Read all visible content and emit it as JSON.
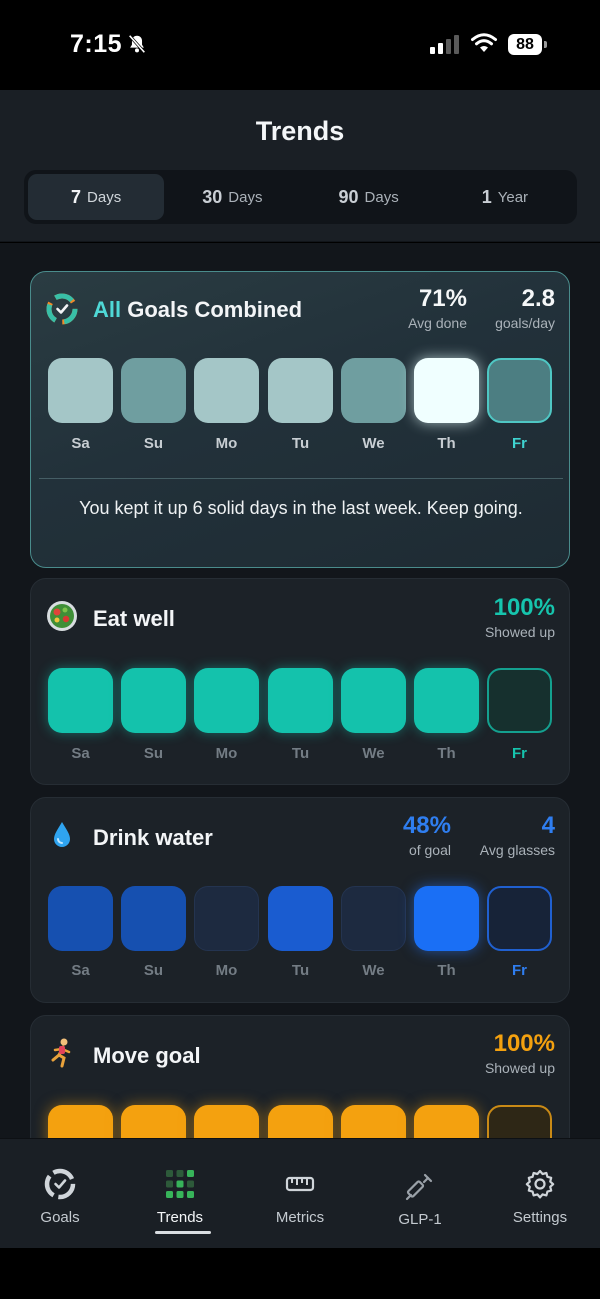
{
  "status": {
    "time": "7:15",
    "battery": "88"
  },
  "header": {
    "title": "Trends",
    "tabs": [
      {
        "num": "7",
        "unit": "Days",
        "active": true
      },
      {
        "num": "30",
        "unit": "Days",
        "active": false
      },
      {
        "num": "90",
        "unit": "Days",
        "active": false
      },
      {
        "num": "1",
        "unit": "Year",
        "active": false
      }
    ]
  },
  "days": [
    "Sa",
    "Su",
    "Mo",
    "Tu",
    "We",
    "Th",
    "Fr"
  ],
  "cards": {
    "combined": {
      "title_accent": "All",
      "title_rest": " Goals Combined",
      "stat1_value": "71%",
      "stat1_label": "Avg done",
      "stat2_value": "2.8",
      "stat2_label": "goals/day",
      "summary": "You kept it up 6 solid days in the last week. Keep going."
    },
    "eat": {
      "title": "Eat well",
      "stat_value": "100%",
      "stat_label": "Showed up",
      "color": "#14c2ac"
    },
    "water": {
      "title": "Drink water",
      "stat1_value": "48%",
      "stat1_label": "of goal",
      "stat2_value": "4",
      "stat2_label": "Avg glasses",
      "color": "#1a6be6"
    },
    "move": {
      "title": "Move goal",
      "stat_value": "100%",
      "stat_label": "Showed up",
      "color": "#f4a10f"
    }
  },
  "nav": {
    "items": [
      {
        "label": "Goals",
        "icon": "goals-icon"
      },
      {
        "label": "Trends",
        "icon": "trends-icon"
      },
      {
        "label": "Metrics",
        "icon": "ruler-icon"
      },
      {
        "label": "GLP-1",
        "icon": "syringe-icon"
      },
      {
        "label": "Settings",
        "icon": "gear-icon"
      }
    ],
    "active": "Trends"
  }
}
